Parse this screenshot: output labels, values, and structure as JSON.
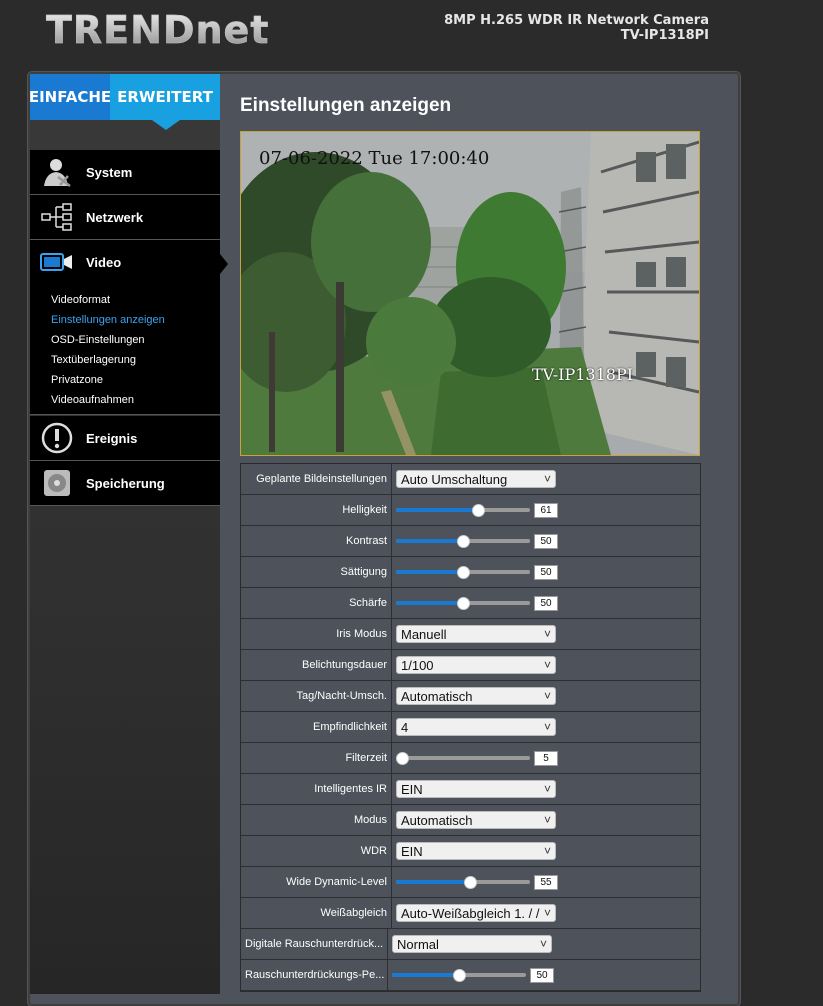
{
  "header": {
    "logo_text": "TRENDnet",
    "product_line": "8MP H.265 WDR IR Network Camera",
    "model": "TV-IP1318PI"
  },
  "mode_tabs": {
    "simple": "EINFACHE",
    "advanced": "ERWEITERT"
  },
  "sidebar": {
    "system": "System",
    "network": "Netzwerk",
    "video": "Video",
    "video_sub": [
      "Videoformat",
      "Einstellungen anzeigen",
      "OSD-Einstellungen",
      "Textüberlagerung",
      "Privatzone",
      "Videoaufnahmen"
    ],
    "event": "Ereignis",
    "storage": "Speicherung"
  },
  "page": {
    "title": "Einstellungen anzeigen",
    "preview_time": "07-06-2022 Tue 17:00:40",
    "preview_name": "TV-IP1318PI"
  },
  "settings": [
    {
      "label": "Geplante Bildeinstellungen",
      "type": "select",
      "value": "Auto Umschaltung"
    },
    {
      "label": "Helligkeit",
      "type": "slider",
      "value": "61",
      "level": 0.61
    },
    {
      "label": "Kontrast",
      "type": "slider",
      "value": "50",
      "level": 0.5
    },
    {
      "label": "Sättigung",
      "type": "slider",
      "value": "50",
      "level": 0.5
    },
    {
      "label": "Schärfe",
      "type": "slider",
      "value": "50",
      "level": 0.5
    },
    {
      "label": "Iris Modus",
      "type": "select",
      "value": "Manuell"
    },
    {
      "label": "Belichtungsdauer",
      "type": "select",
      "value": "1/100"
    },
    {
      "label": "Tag/Nacht-Umsch.",
      "type": "select",
      "value": "Automatisch"
    },
    {
      "label": "Empfindlichkeit",
      "type": "select",
      "value": "4"
    },
    {
      "label": "Filterzeit",
      "type": "slider",
      "value": "5",
      "level": 0.0
    },
    {
      "label": "Intelligentes IR",
      "type": "select",
      "value": "EIN"
    },
    {
      "label": "Modus",
      "type": "select",
      "value": "Automatisch"
    },
    {
      "label": "WDR",
      "type": "select",
      "value": "EIN"
    },
    {
      "label": "Wide Dynamic-Level",
      "type": "slider",
      "value": "55",
      "level": 0.55
    },
    {
      "label": "Weißabgleich",
      "type": "select",
      "value": "Auto-Weißabgleich 1. / /"
    },
    {
      "label": "Digitale Rauschunterdrück...",
      "type": "select",
      "value": "Normal"
    },
    {
      "label": "Rauschunterdrückungs-Pe...",
      "type": "slider",
      "value": "50",
      "level": 0.5
    }
  ],
  "colors": {
    "accent": "#1a7ad1",
    "active_link": "#3aa3f0",
    "panel": "#4d525b"
  }
}
